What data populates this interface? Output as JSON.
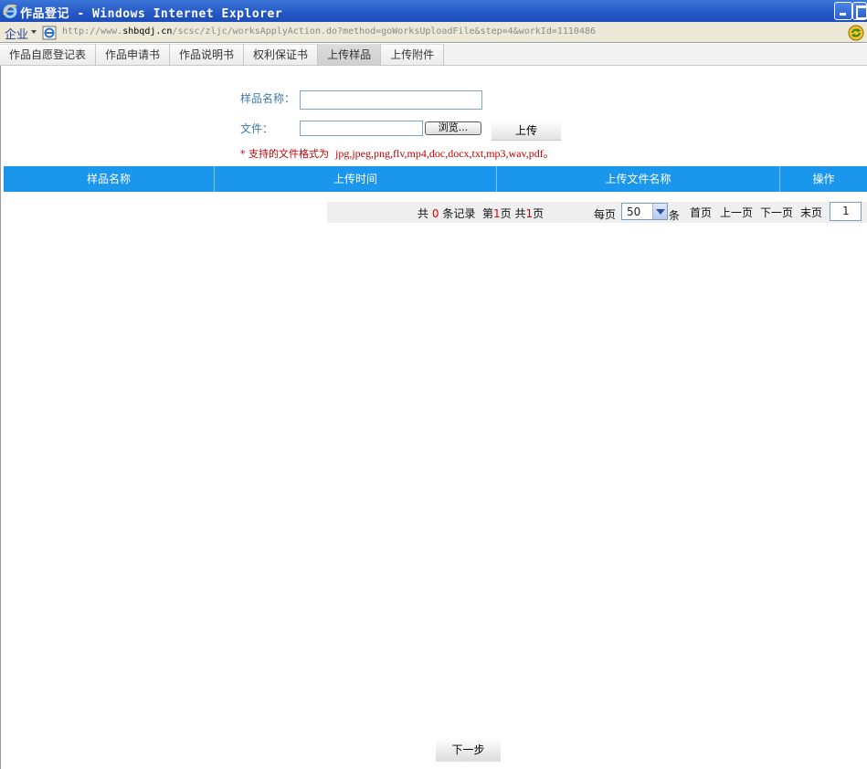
{
  "window": {
    "title": "作品登记 - Windows Internet Explorer"
  },
  "addressbar": {
    "zone": "企业",
    "url_prefix": "http://www.",
    "url_domain": "shbqdj.cn",
    "url_path": "/scsc/zljc/worksApplyAction.do?method=goWorksUploadFile&step=4&workId=1110486"
  },
  "tabs": [
    {
      "label": "作品自愿登记表"
    },
    {
      "label": "作品申请书"
    },
    {
      "label": "作品说明书"
    },
    {
      "label": "权利保证书"
    },
    {
      "label": "上传样品"
    },
    {
      "label": "上传附件"
    }
  ],
  "form": {
    "sample_name_label": "样品名称：",
    "sample_name_value": "",
    "file_label": "文件：",
    "file_value": "",
    "browse_label": "浏览...",
    "upload_label": "上传",
    "hint_prefix": "* 支持的文件格式为",
    "hint_formats": "jpg,jpeg,png,flv,mp4,doc,docx,txt,mp3,wav,pdf。"
  },
  "table": {
    "columns": [
      "样品名称",
      "上传时间",
      "上传文件名称",
      "操作"
    ],
    "rows": []
  },
  "pager": {
    "total_prefix": "共",
    "total_count": "0",
    "total_suffix": "条记录",
    "page_prefix": "第",
    "current_page": "1",
    "page_mid": "页 共",
    "page_count": "1",
    "page_suffix": "页",
    "per_page_label": "每页",
    "per_page_value": "50",
    "per_page_unit": "条",
    "first": "首页",
    "prev": "上一页",
    "next": "下一页",
    "last": "末页",
    "goto_value": "1"
  },
  "footer": {
    "next_step_label": "下一步"
  },
  "colors": {
    "header_bg": "#1a96ec",
    "hint": "#c00000",
    "label": "#3d7aa8"
  }
}
